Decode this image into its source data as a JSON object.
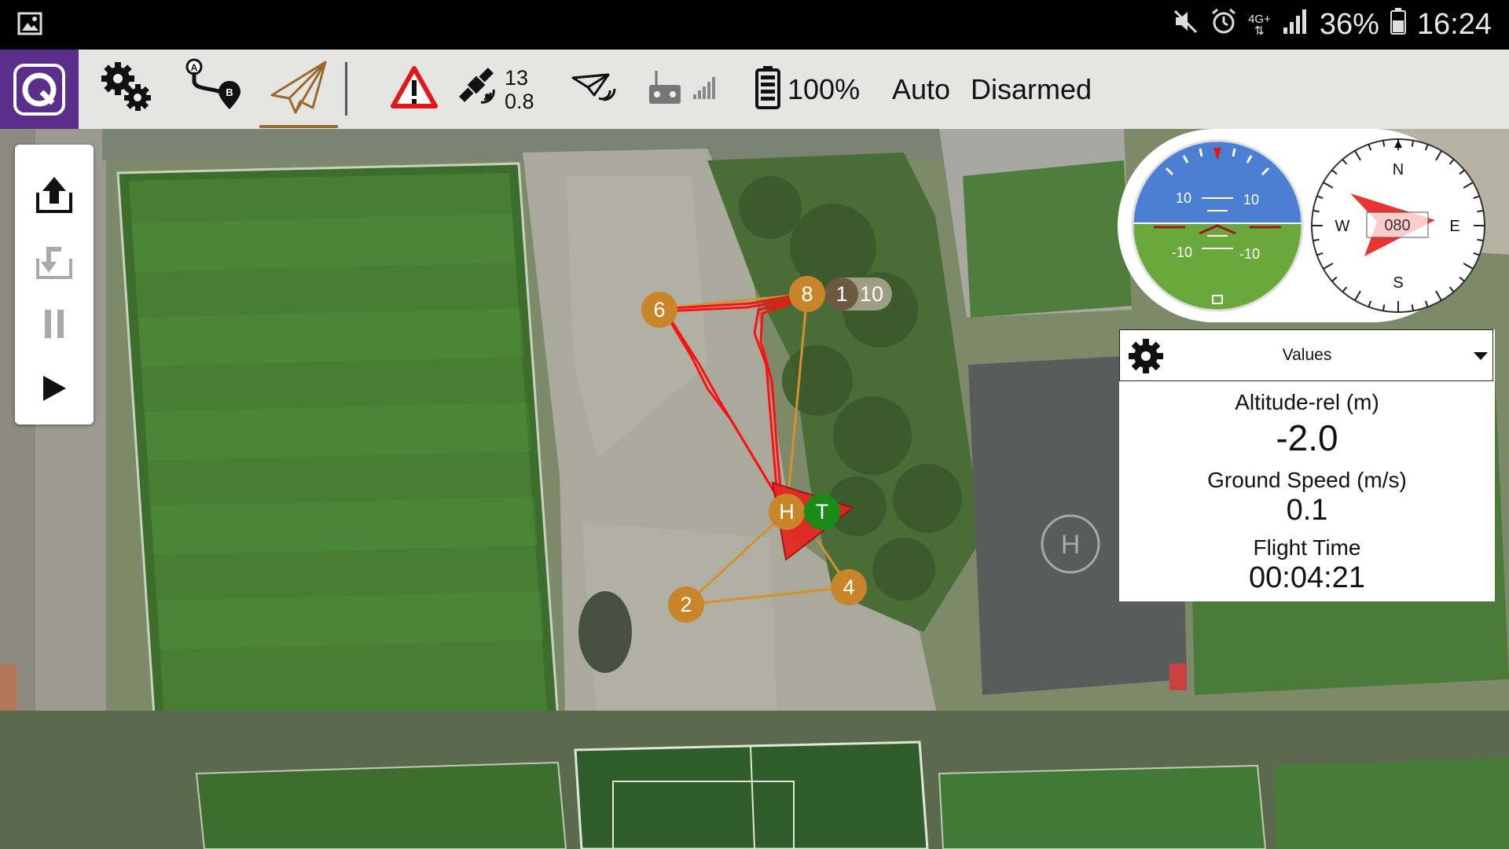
{
  "statusbar": {
    "left_icon": "image-icon",
    "network_type": "4G+",
    "battery_percent": "36%",
    "time": "16:24",
    "icons": [
      "mute-icon",
      "alarm-icon",
      "network-icon",
      "signal-icon",
      "battery-icon"
    ]
  },
  "toolbar": {
    "logo": "qgc-logo-icon",
    "settings_icon": "settings-gears-icon",
    "plan_icon": "plan-route-icon",
    "fly_icon": "fly-paper-plane-icon",
    "warning_icon": "warning-icon",
    "gps_sat_count": "13",
    "gps_hdop": "0.8",
    "battery": "100%",
    "flight_mode": "Auto",
    "arm_state": "Disarmed"
  },
  "map": {
    "home_label": "H",
    "takeoff_label": "T",
    "waypoints": [
      "2",
      "4",
      "6",
      "8"
    ],
    "mission_counter_current": "1",
    "mission_counter_total": "10",
    "colors": {
      "waypoint": "#c9852a",
      "takeoff": "#1a8a1a",
      "track": "#ff1010",
      "vehicle": "#e8231f"
    }
  },
  "flytools": {
    "items": [
      "takeoff-icon",
      "rtl-icon",
      "pause-icon",
      "start-mission-icon"
    ]
  },
  "instruments": {
    "attitude": {
      "pitch_labels": [
        "10",
        "10",
        "-10",
        "-10"
      ],
      "sky_color": "#4a7fd4",
      "ground_color": "#6aa83c"
    },
    "compass": {
      "north": "N",
      "east": "E",
      "south": "S",
      "west": "W",
      "heading": "080"
    }
  },
  "values_widget": {
    "title": "Values",
    "items": [
      {
        "label": "Altitude-rel (m)",
        "value": "-2.0"
      },
      {
        "label": "Ground Speed (m/s)",
        "value": "0.1"
      },
      {
        "label": "Flight Time",
        "value": "00:04:21"
      }
    ]
  }
}
